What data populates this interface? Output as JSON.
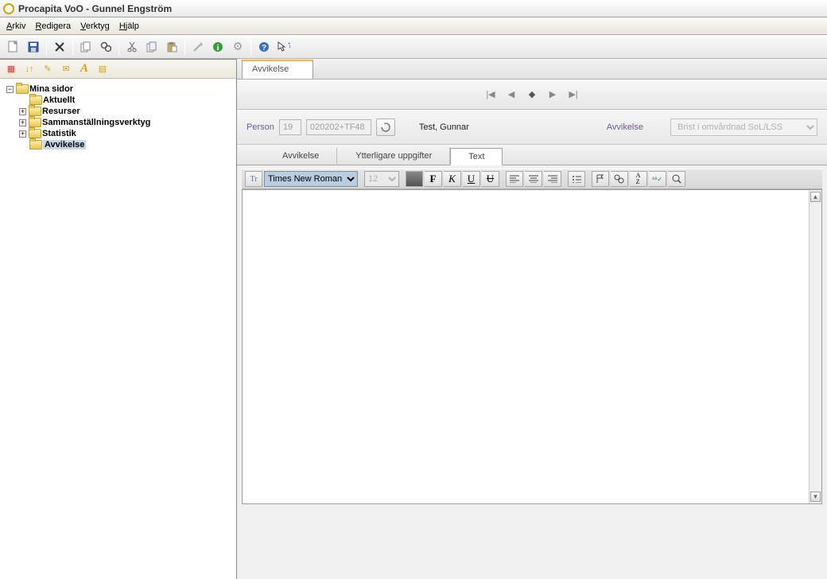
{
  "title": "Procapita VoO - Gunnel Engström",
  "menu": {
    "arkiv": "Arkiv",
    "redigera": "Redigera",
    "verktyg": "Verktyg",
    "hjalp": "Hjälp"
  },
  "tree": {
    "root": "Mina sidor",
    "aktuellt": "Aktuellt",
    "resurser": "Resurser",
    "samman": "Sammanställningsverktyg",
    "statistik": "Statistik",
    "avvikelse": "Avvikelse"
  },
  "doc_tab": "Avvikelse",
  "form": {
    "person_label": "Person",
    "id_value": "19",
    "code_value": "020202+TF48",
    "person_name": "Test, Gunnar",
    "avvikelse_label": "Avvikelse",
    "dropdown_value": "Brist i omvårdnad SoL/LSS"
  },
  "inner_tabs": {
    "t1": "Avvikelse",
    "t2": "Ytterligare uppgifter",
    "t3": "Text"
  },
  "editor": {
    "font": "Times New Roman",
    "size": "12"
  }
}
